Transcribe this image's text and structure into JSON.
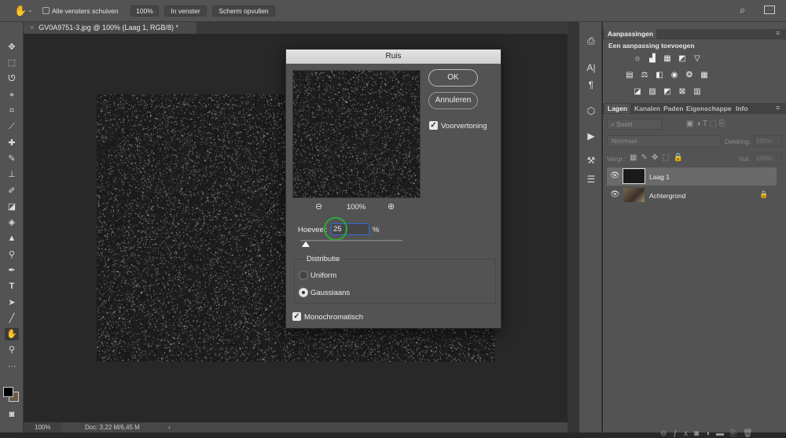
{
  "optionbar": {
    "tool_icon": "hand-icon",
    "checkbox_label": "Alle vensters schuiven",
    "checkbox_checked": false,
    "buttons": [
      "100%",
      "In venster",
      "Scherm opvullen"
    ]
  },
  "document_tab": {
    "close": "×",
    "title": "GV0A9751-3.jpg @ 100% (Laag 1, RGB/8) *"
  },
  "status": {
    "zoom": "100%",
    "doc": "Doc: 3,22 M/6,45 M",
    "arrow": "›"
  },
  "panels": {
    "adjustments": {
      "tab": "Aanpassingen",
      "subtitle": "Een aanpassing toevoegen"
    },
    "layers_tabs": [
      "Lagen",
      "Kanalen",
      "Paden",
      "Eigenschappen",
      "Info"
    ],
    "filter": "Soort",
    "blend_mode": "Normaal",
    "opacity_label": "Dekking:",
    "opacity": "100%",
    "lock_label": "Vergr.:",
    "fill_label": "Vul:",
    "fill": "100%",
    "layers": [
      {
        "name": "Laag 1",
        "visible": true,
        "selected": true
      },
      {
        "name": "Achtergrond",
        "visible": true,
        "locked": true
      }
    ]
  },
  "dialog": {
    "title": "Ruis",
    "ok": "OK",
    "cancel": "Annuleren",
    "preview_label": "Voorvertoning",
    "preview_checked": true,
    "zoom": "100%",
    "amount_label": "Hoeveel:",
    "amount": "25",
    "amount_unit": "%",
    "amount_fraction": 0.05,
    "distribution_label": "Distributie",
    "options": [
      "Uniform",
      "Gaussiaans"
    ],
    "selected_option": "Gaussiaans",
    "mono_label": "Monochromatisch",
    "mono_checked": true
  },
  "colors": {
    "accent_focus": "#2d6bd6",
    "cursor_ring": "#2fa83a",
    "foreground": "#000000",
    "background": "#6b5a4a"
  }
}
